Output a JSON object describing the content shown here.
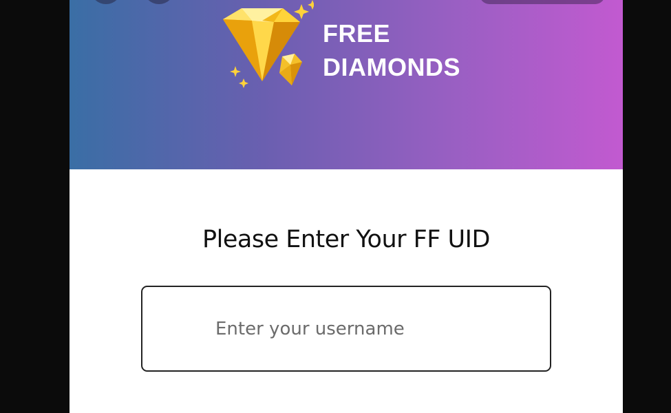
{
  "header": {
    "title_line1": "FREE",
    "title_line2": "DIAMONDS",
    "logo_icon": "diamond-icon",
    "colors": {
      "gradient_start": "#3a6ea5",
      "gradient_end": "#c25ad0",
      "diamond": "#f5c518"
    }
  },
  "form": {
    "prompt": "Please Enter Your FF UID",
    "username_placeholder": "Enter your username",
    "username_value": ""
  }
}
